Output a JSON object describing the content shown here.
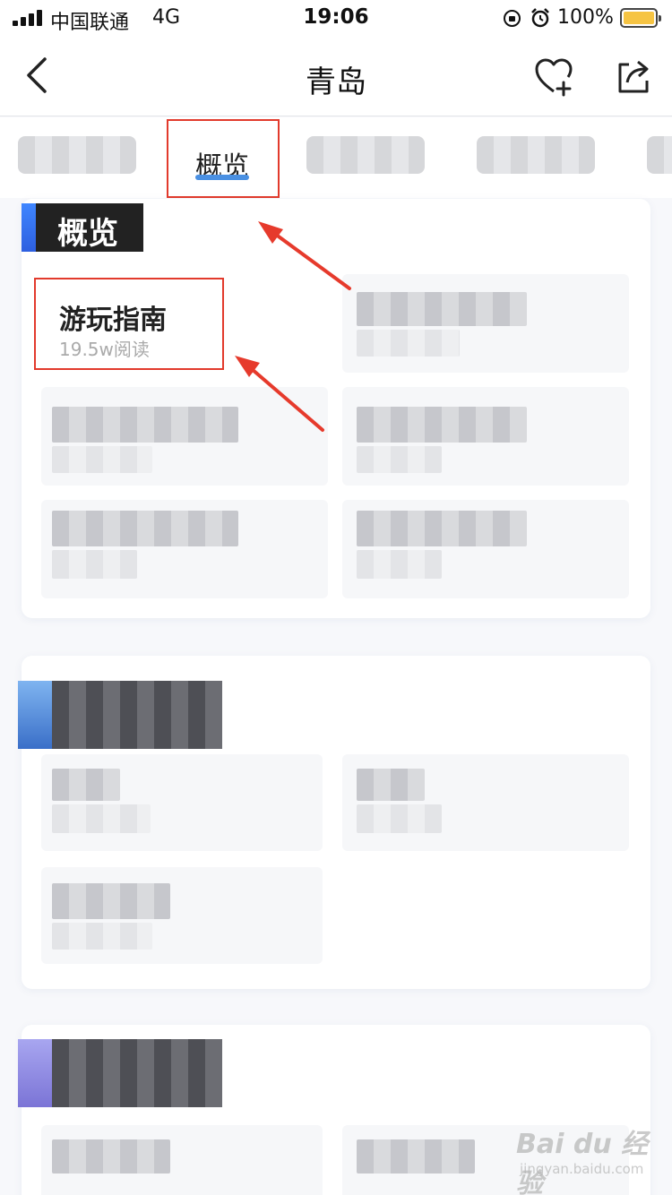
{
  "status_bar": {
    "carrier": "中国联通",
    "network": "4G",
    "time": "19:06",
    "battery": "100%",
    "battery_level": 1.0
  },
  "nav": {
    "title": "青岛"
  },
  "tabs": {
    "active_label": "概览"
  },
  "overview_section": {
    "title": "概览",
    "guide": {
      "title": "游玩指南",
      "reads": "19.5w阅读"
    }
  },
  "watermark": {
    "main": "Bai du 经验",
    "sub": "jingyan.baidu.com"
  },
  "colors": {
    "highlight_border": "#e23a2c",
    "tab_underline": "#4a90e2",
    "section_accent": "#3f86ff",
    "battery": "#f6c443"
  }
}
